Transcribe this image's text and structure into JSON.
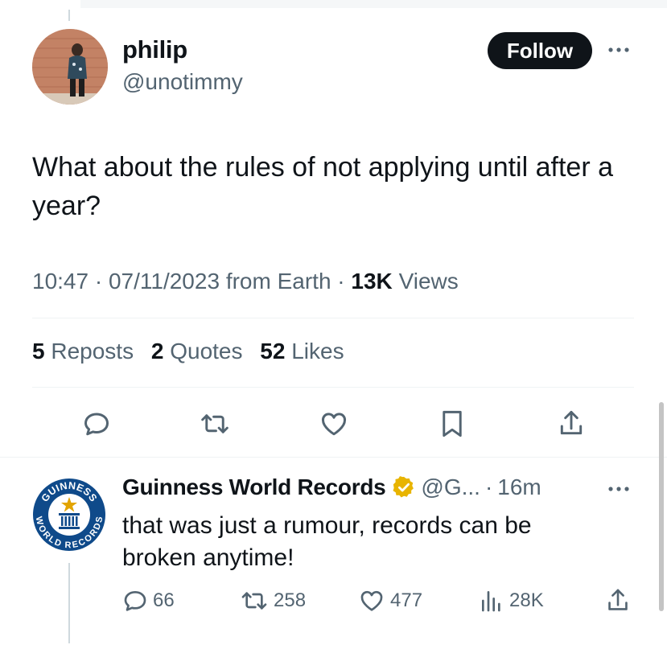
{
  "tweet": {
    "author_name": "philip",
    "author_handle": "@unotimmy",
    "follow_label": "Follow",
    "text": "What about the rules of not applying until after a year?",
    "time": "10:47",
    "date": "07/11/2023",
    "source": "from Earth",
    "views_count": "13K",
    "views_label": "Views",
    "reposts_count": "5",
    "reposts_label": "Reposts",
    "quotes_count": "2",
    "quotes_label": "Quotes",
    "likes_count": "52",
    "likes_label": "Likes"
  },
  "reply": {
    "author_name": "Guinness World Records",
    "author_handle": "@G...",
    "time": "16m",
    "text": "that was just a rumour, records can be broken anytime!",
    "replies": "66",
    "reposts": "258",
    "likes": "477",
    "views": "28K",
    "logo_text_top": "GUINNESS",
    "logo_text_bottom": "WORLD RECORDS"
  },
  "icons": [
    "more-icon",
    "reply-icon",
    "repost-icon",
    "like-icon",
    "bookmark-icon",
    "share-icon",
    "verified-badge-icon",
    "views-icon"
  ],
  "colors": {
    "text": "#0f1419",
    "secondary": "#536471",
    "follow_bg": "#0f1419",
    "gwr_blue": "#0f4a8a",
    "gwr_gold": "#e2a400"
  }
}
